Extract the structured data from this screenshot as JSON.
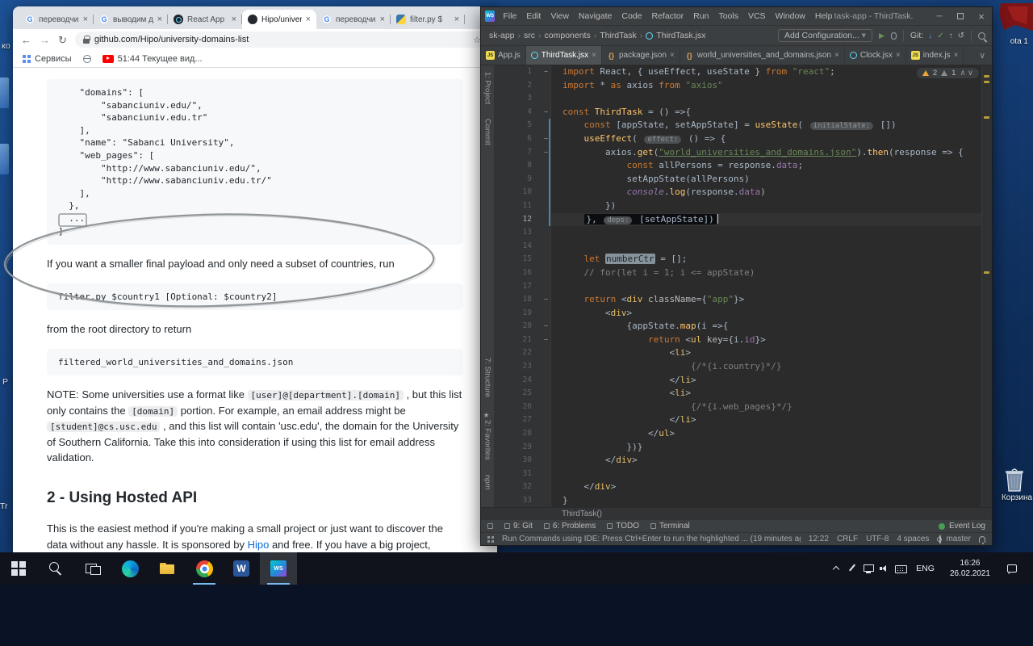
{
  "desktop": {
    "edge_fragments": [
      "ко",
      "P",
      "Tr"
    ],
    "corner_icon_label": "ota 1",
    "recycle_bin_label": "Корзина"
  },
  "browser": {
    "tabs": [
      {
        "label": "переводчик",
        "favicon": "google"
      },
      {
        "label": "выводим д",
        "favicon": "google"
      },
      {
        "label": "React App",
        "favicon": "react"
      },
      {
        "label": "Hipo/univer",
        "favicon": "github",
        "active": true
      },
      {
        "label": "переводчик",
        "favicon": "google"
      },
      {
        "label": "filter.py $",
        "favicon": "python"
      }
    ],
    "toolbar": {
      "url": "github.com/Hipo/university-domains-list"
    },
    "bookmarks_bar": {
      "services_label": "Сервисы",
      "youtube_bookmark": "51:44 Текущее вид..."
    },
    "readme": {
      "json_snippet": [
        "    \"domains\": [",
        "        \"sabanciuniv.edu/\",",
        "        \"sabanciuniv.edu.tr\"",
        "    ],",
        "    \"name\": \"Sabanci University\",",
        "    \"web_pages\": [",
        "        \"http://www.sabanciuniv.edu/\",",
        "        \"http://www.sabanciuniv.edu.tr/\"",
        "    ],",
        "  },",
        "  ...",
        "]"
      ],
      "para_filter_intro": "If you want a smaller final payload and only need a subset of countries, run",
      "code_filter": "filter.py $country1 [Optional: $country2]",
      "para_root_dir": "from the root directory to return",
      "code_filtered": "filtered_world_universities_and_domains.json",
      "note": [
        {
          "t": "NOTE: Some universities use a format like "
        },
        {
          "t": "[user]@[department].[domain]",
          "code": true
        },
        {
          "t": " , but this list only contains the "
        },
        {
          "t": "[domain]",
          "code": true
        },
        {
          "t": " portion. For example, an email address might be "
        },
        {
          "t": "[student]@cs.usc.edu",
          "code": true
        },
        {
          "t": " , and this list will contain 'usc.edu', the domain for the University of Southern California. Take this into consideration if using this list for email address validation."
        }
      ],
      "heading_api": "2 - Using Hosted API",
      "para_api": [
        {
          "t": "This is the easiest method if you're making a small project or just want to discover the data without any hassle. It is sponsored by "
        },
        {
          "t": "Hipo",
          "link": true
        },
        {
          "t": " and free. If you have a big project, please host it on your own server."
        }
      ]
    }
  },
  "ide": {
    "title": "task-app - ThirdTask.jsx",
    "menu": [
      "File",
      "Edit",
      "View",
      "Navigate",
      "Code",
      "Refactor",
      "Run",
      "Tools",
      "VCS",
      "Window",
      "Help"
    ],
    "nav_breadcrumbs": [
      "sk-app",
      "src",
      "components",
      "ThirdTask",
      "ThirdTask.jsx"
    ],
    "add_configuration": "Add Configuration...",
    "git_label": "Git:",
    "editor_tabs": [
      {
        "label": "App.js",
        "icon": "js",
        "close": false
      },
      {
        "label": "ThirdTask.jsx",
        "icon": "react",
        "close": true,
        "active": true
      },
      {
        "label": "package.json",
        "icon": "json",
        "close": true
      },
      {
        "label": "world_universities_and_domains.json",
        "icon": "json",
        "close": true
      },
      {
        "label": "Clock.jsx",
        "icon": "react",
        "close": true
      },
      {
        "label": "index.js",
        "icon": "js",
        "close": true
      }
    ],
    "inspections": {
      "warnings": "2",
      "weak_warnings": "1"
    },
    "tool_stripe_top": [
      "1: Project",
      "Commit"
    ],
    "tool_stripe_bottom": [
      "7: Structure",
      "2: Favorites",
      "npm"
    ],
    "code": [
      {
        "n": 1,
        "fold": true,
        "seg": [
          [
            "kw",
            "import "
          ],
          [
            "pl",
            "React, { useEffect, useState } "
          ],
          [
            "kw",
            "from "
          ],
          [
            "str",
            "\"react\""
          ],
          [
            "pl",
            ";"
          ]
        ]
      },
      {
        "n": 2,
        "seg": [
          [
            "kw",
            "import "
          ],
          [
            "pl",
            "* "
          ],
          [
            "kw",
            "as "
          ],
          [
            "pl",
            "axios "
          ],
          [
            "kw",
            "from "
          ],
          [
            "str",
            "\"axios\""
          ]
        ]
      },
      {
        "n": 3,
        "seg": []
      },
      {
        "n": 4,
        "fold": true,
        "seg": [
          [
            "kw",
            "const "
          ],
          [
            "fn",
            "ThirdTask"
          ],
          [
            "pl",
            " = () =>{"
          ]
        ]
      },
      {
        "n": 5,
        "seg": [
          [
            "pl",
            "    "
          ],
          [
            "kw",
            "const "
          ],
          [
            "pl",
            "[appState, setAppState] = "
          ],
          [
            "fn",
            "useState"
          ],
          [
            "pl",
            "( "
          ],
          [
            "hint",
            "initialState:"
          ],
          [
            "pl",
            " [])"
          ]
        ]
      },
      {
        "n": 6,
        "fold": true,
        "seg": [
          [
            "pl",
            "    "
          ],
          [
            "fn",
            "useEffect"
          ],
          [
            "pl",
            "( "
          ],
          [
            "hint",
            "effect:"
          ],
          [
            "pl",
            " () => {"
          ]
        ]
      },
      {
        "n": 7,
        "fold": true,
        "seg": [
          [
            "pl",
            "        axios."
          ],
          [
            "fn",
            "get"
          ],
          [
            "pl",
            "("
          ],
          [
            "strU",
            "\"world_universities_and_domains.json\""
          ],
          [
            "pl",
            ")."
          ],
          [
            "fn",
            "then"
          ],
          [
            "pl",
            "(response => {"
          ]
        ]
      },
      {
        "n": 8,
        "seg": [
          [
            "pl",
            "            "
          ],
          [
            "kw",
            "const "
          ],
          [
            "pl",
            "allPersons = response."
          ],
          [
            "fld",
            "data"
          ],
          [
            "pl",
            ";"
          ]
        ]
      },
      {
        "n": 9,
        "seg": [
          [
            "pl",
            "            setAppState(allPersons)"
          ]
        ]
      },
      {
        "n": 10,
        "seg": [
          [
            "pl",
            "            "
          ],
          [
            "glob",
            "console"
          ],
          [
            "pl",
            "."
          ],
          [
            "fn",
            "log"
          ],
          [
            "pl",
            "(response."
          ],
          [
            "fld",
            "data"
          ],
          [
            "pl",
            ")"
          ]
        ]
      },
      {
        "n": 11,
        "seg": [
          [
            "pl",
            "        })"
          ]
        ]
      },
      {
        "n": 12,
        "active": true,
        "caret": true,
        "seg": [
          [
            "pl",
            "    "
          ]
        ],
        "boxseg": [
          [
            "pl",
            "}, "
          ],
          [
            "hint",
            "deps:"
          ],
          [
            "pl",
            " [setAppState])"
          ]
        ]
      },
      {
        "n": 13,
        "seg": []
      },
      {
        "n": 14,
        "seg": []
      },
      {
        "n": 15,
        "seg": [
          [
            "pl",
            "    "
          ],
          [
            "kw",
            "let "
          ],
          [
            "hl",
            "numberCtr"
          ],
          [
            "pl",
            " = [];"
          ]
        ]
      },
      {
        "n": 16,
        "seg": [
          [
            "pl",
            "    "
          ],
          [
            "cmt",
            "// for(let i = 1; i <= appState)"
          ]
        ]
      },
      {
        "n": 17,
        "seg": []
      },
      {
        "n": 18,
        "fold": true,
        "seg": [
          [
            "pl",
            "    "
          ],
          [
            "kw",
            "return "
          ],
          [
            "pl",
            "<"
          ],
          [
            "tag",
            "div"
          ],
          [
            "attr",
            " className"
          ],
          [
            "pl",
            "={"
          ],
          [
            "str",
            "\"app\""
          ],
          [
            "pl",
            "}>"
          ]
        ]
      },
      {
        "n": 19,
        "seg": [
          [
            "pl",
            "        <"
          ],
          [
            "tag",
            "div"
          ],
          [
            "pl",
            ">"
          ]
        ]
      },
      {
        "n": 20,
        "fold": true,
        "seg": [
          [
            "pl",
            "            {appState."
          ],
          [
            "fn",
            "map"
          ],
          [
            "pl",
            "(i =>{"
          ]
        ]
      },
      {
        "n": 21,
        "fold": true,
        "seg": [
          [
            "pl",
            "                "
          ],
          [
            "kw",
            "return "
          ],
          [
            "pl",
            "<"
          ],
          [
            "tag",
            "ul"
          ],
          [
            "attr",
            " key"
          ],
          [
            "pl",
            "={i."
          ],
          [
            "fld",
            "id"
          ],
          [
            "pl",
            "}>"
          ]
        ]
      },
      {
        "n": 22,
        "seg": [
          [
            "pl",
            "                    <"
          ],
          [
            "tag",
            "li"
          ],
          [
            "pl",
            ">"
          ]
        ]
      },
      {
        "n": 23,
        "seg": [
          [
            "pl",
            "                        "
          ],
          [
            "cmt",
            "{/*{i.country}*/}"
          ]
        ]
      },
      {
        "n": 24,
        "seg": [
          [
            "pl",
            "                    </"
          ],
          [
            "tag",
            "li"
          ],
          [
            "pl",
            ">"
          ]
        ]
      },
      {
        "n": 25,
        "seg": [
          [
            "pl",
            "                    <"
          ],
          [
            "tag",
            "li"
          ],
          [
            "pl",
            ">"
          ]
        ]
      },
      {
        "n": 26,
        "seg": [
          [
            "pl",
            "                        "
          ],
          [
            "cmt",
            "{/*{i.web_pages}*/}"
          ]
        ]
      },
      {
        "n": 27,
        "seg": [
          [
            "pl",
            "                    </"
          ],
          [
            "tag",
            "li"
          ],
          [
            "pl",
            ">"
          ]
        ]
      },
      {
        "n": 28,
        "seg": [
          [
            "pl",
            "                </"
          ],
          [
            "tag",
            "ul"
          ],
          [
            "pl",
            ">"
          ]
        ]
      },
      {
        "n": 29,
        "seg": [
          [
            "pl",
            "            })}"
          ]
        ]
      },
      {
        "n": 30,
        "seg": [
          [
            "pl",
            "        </"
          ],
          [
            "tag",
            "div"
          ],
          [
            "pl",
            ">"
          ]
        ]
      },
      {
        "n": 31,
        "seg": []
      },
      {
        "n": 32,
        "seg": [
          [
            "pl",
            "    </"
          ],
          [
            "tag",
            "div"
          ],
          [
            "pl",
            ">"
          ]
        ]
      },
      {
        "n": 33,
        "seg": [
          [
            "pl",
            "}"
          ]
        ]
      }
    ],
    "footer_breadcrumb": "ThirdTask()",
    "bottom_tools": {
      "left": [
        "9: Git",
        "6: Problems",
        "TODO",
        "Terminal"
      ],
      "event_log": "Event Log"
    },
    "status": {
      "message": "Run Commands using IDE: Press Ctrl+Enter to run the highlighted ... (19 minutes ago)",
      "position": "12:22",
      "line_sep": "CRLF",
      "encoding": "UTF-8",
      "indent": "4 spaces",
      "branch": "master"
    }
  },
  "taskbar": {
    "buttons": [
      {
        "name": "start"
      },
      {
        "name": "search"
      },
      {
        "name": "task-view"
      },
      {
        "name": "edge"
      },
      {
        "name": "file-explorer"
      },
      {
        "name": "chrome",
        "running": true
      },
      {
        "name": "word"
      },
      {
        "name": "webstorm",
        "running": true,
        "active": true
      }
    ],
    "tray_icons": [
      "chevron-up",
      "pen",
      "network",
      "volume",
      "keyboard"
    ],
    "language": "ENG",
    "time": "16:26",
    "date": "26.02.2021"
  }
}
